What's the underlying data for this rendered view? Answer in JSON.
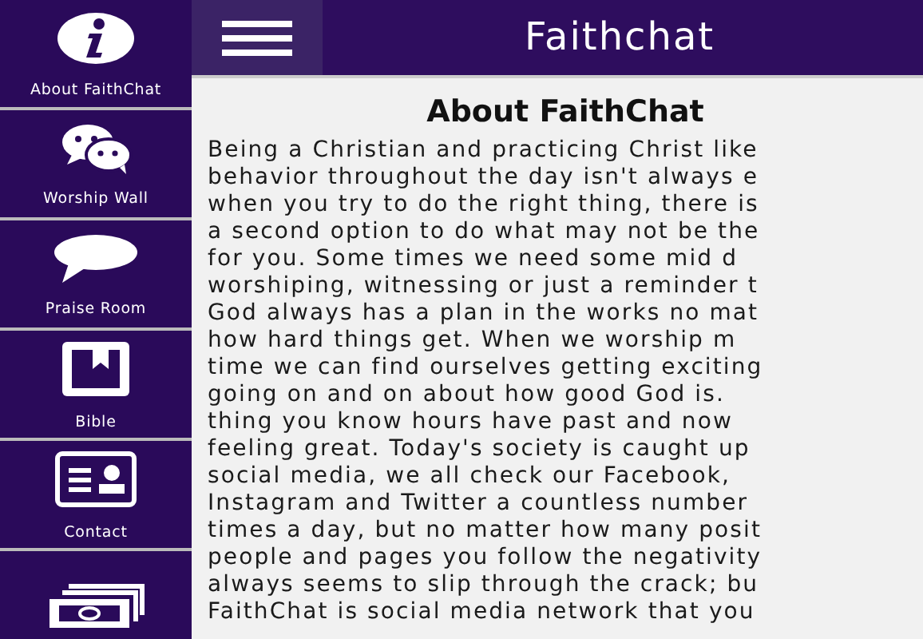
{
  "sidebar": {
    "items": [
      {
        "kind": "info",
        "label": "About FaithChat"
      },
      {
        "kind": "chats",
        "label": "Worship Wall"
      },
      {
        "kind": "bubble",
        "label": "Praise Room"
      },
      {
        "kind": "book",
        "label": "Bible"
      },
      {
        "kind": "contact",
        "label": "Contact"
      },
      {
        "kind": "money"
      }
    ]
  },
  "header": {
    "title": "Faithchat"
  },
  "content": {
    "heading": "About FaithChat",
    "lines": [
      "Being a Christian and practicing Christ like",
      "behavior throughout the day isn't always e",
      "when you try to do the right thing, there is",
      "a second option to do what may not be the",
      "for you. Some times we need some mid d",
      "worshiping, witnessing or just a reminder t",
      "God always has a plan in the works no mat",
      "how hard things get. When we  worship m",
      "time we can find ourselves getting exciting",
      "going on and on about how good God is.",
      "thing you know hours have past and now",
      "feeling great. Today's society is caught up",
      "social media, we all check our Facebook,",
      "Instagram and Twitter a countless number",
      "times a day, but no matter how many posit",
      "people and pages you follow the negativity",
      "always seems to slip through the crack; bu",
      "FaithChat is social media network that you"
    ]
  }
}
